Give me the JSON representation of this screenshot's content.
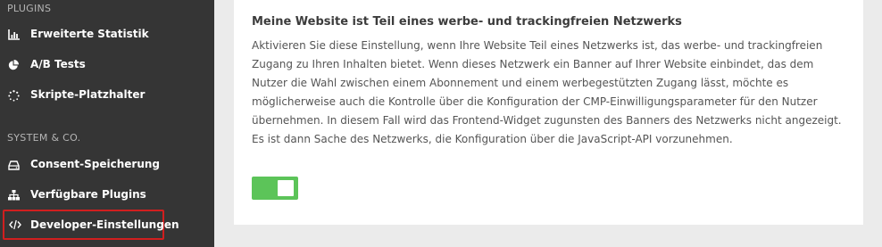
{
  "sidebar": {
    "sections": [
      {
        "title": "PLUGINS",
        "items": [
          {
            "label": "Erweiterte Statistik",
            "icon": "bar-chart-icon"
          },
          {
            "label": "A/B Tests",
            "icon": "pie-chart-icon"
          },
          {
            "label": "Skripte-Platzhalter",
            "icon": "spinner-icon"
          }
        ]
      },
      {
        "title": "SYSTEM & CO.",
        "items": [
          {
            "label": "Consent-Speicherung",
            "icon": "storage-drive-icon"
          },
          {
            "label": "Verfügbare Plugins",
            "icon": "sitemap-icon"
          },
          {
            "label": "Developer-Einstellungen",
            "icon": "code-icon",
            "active": true
          }
        ]
      }
    ]
  },
  "setting": {
    "title": "Meine Website ist Teil eines werbe- und trackingfreien Netzwerks",
    "description": "Aktivieren Sie diese Einstellung, wenn Ihre Website Teil eines Netzwerks ist, das werbe- und trackingfreien Zugang zu Ihren Inhalten bietet. Wenn dieses Netzwerk ein Banner auf Ihrer Website einbindet, das dem Nutzer die Wahl zwischen einem Abonnement und einem werbegestützten Zugang lässt, möchte es möglicherweise auch die Kontrolle über die Konfiguration der CMP-Einwilligungsparameter für den Nutzer übernehmen. In diesem Fall wird das Frontend-Widget zugunsten des Banners des Netzwerks nicht angezeigt. Es ist dann Sache des Netzwerks, die Konfiguration über die JavaScript-API vorzunehmen.",
    "toggle_on": true
  },
  "colors": {
    "sidebar_bg": "#353535",
    "toggle_on": "#5cc459",
    "active_highlight": "#d11f1f"
  }
}
